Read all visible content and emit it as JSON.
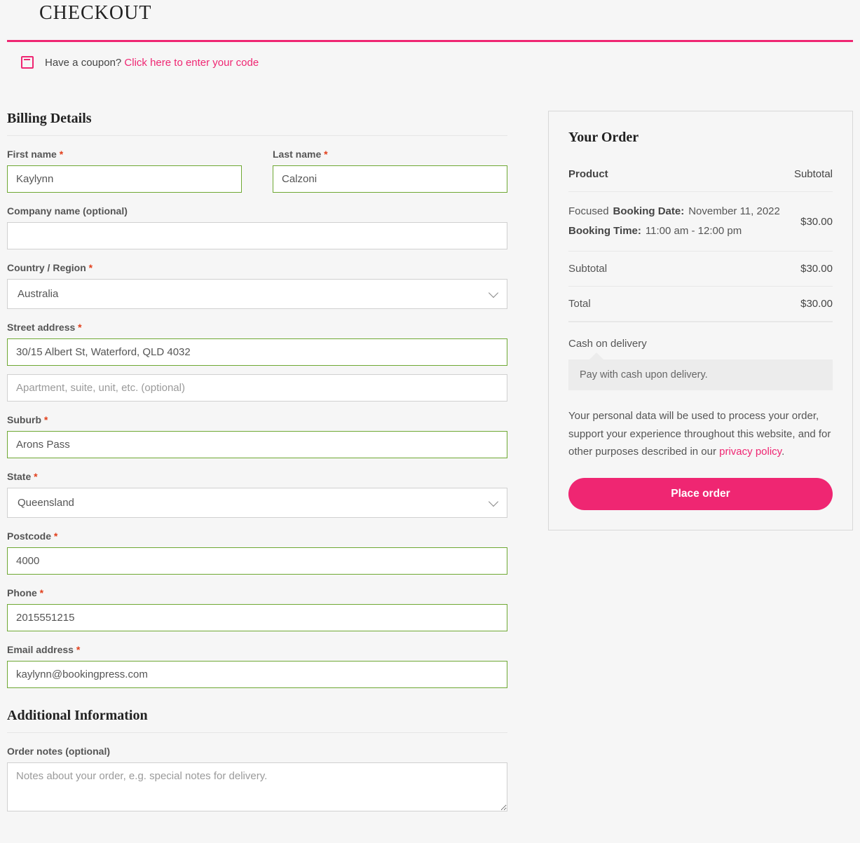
{
  "page_title": "CHECKOUT",
  "coupon": {
    "prompt": "Have a coupon? ",
    "link": "Click here to enter your code"
  },
  "billing": {
    "heading": "Billing Details",
    "first_name": {
      "label": "First name ",
      "value": "Kaylynn"
    },
    "last_name": {
      "label": "Last name ",
      "value": "Calzoni"
    },
    "company": {
      "label": "Company name (optional)",
      "value": ""
    },
    "country": {
      "label": "Country / Region ",
      "value": "Australia"
    },
    "street": {
      "label": "Street address ",
      "value": "30/15 Albert St, Waterford, QLD 4032",
      "placeholder2": "Apartment, suite, unit, etc. (optional)"
    },
    "suburb": {
      "label": "Suburb ",
      "value": "Arons Pass"
    },
    "state": {
      "label": "State ",
      "value": "Queensland"
    },
    "postcode": {
      "label": "Postcode ",
      "value": "4000"
    },
    "phone": {
      "label": "Phone ",
      "value": "2015551215"
    },
    "email": {
      "label": "Email address ",
      "value": "kaylynn@bookingpress.com"
    }
  },
  "additional": {
    "heading": "Additional Information",
    "order_notes": {
      "label": "Order notes (optional)",
      "placeholder": "Notes about your order, e.g. special notes for delivery."
    }
  },
  "order": {
    "heading": "Your Order",
    "head_product": "Product",
    "head_subtotal": "Subtotal",
    "item": {
      "name": "Focused",
      "date_label": "Booking Date:",
      "date_value": "November 11, 2022",
      "time_label": "Booking Time:",
      "time_value": "11:00 am - 12:00 pm",
      "price": "$30.00"
    },
    "subtotal_label": "Subtotal",
    "subtotal_value": "$30.00",
    "total_label": "Total",
    "total_value": "$30.00",
    "payment_method": "Cash on delivery",
    "payment_desc": "Pay with cash upon delivery.",
    "privacy_pre": "Your personal data will be used to process your order, support your experience throughout this website, and for other purposes described in our ",
    "privacy_link": "privacy policy",
    "place_button": "Place order"
  },
  "asterisk": "*"
}
